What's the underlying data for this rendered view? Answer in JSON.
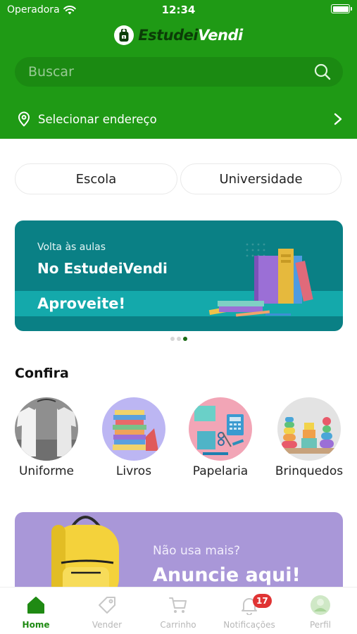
{
  "status_bar": {
    "carrier": "Operadora",
    "time": "12:34"
  },
  "header": {
    "logo_part1": "Estudei",
    "logo_part2": "Vendi",
    "search_placeholder": "Buscar",
    "address_label": "Selecionar endereço"
  },
  "segments": [
    {
      "label": "Escola"
    },
    {
      "label": "Universidade"
    }
  ],
  "banner": {
    "small": "Volta às aulas",
    "big": "No EstudeiVendi",
    "cta": "Aproveite!",
    "page_count": 3,
    "active_page": 3
  },
  "section_title": "Confira",
  "categories": [
    {
      "label": "Uniforme",
      "icon": "tshirt-photo"
    },
    {
      "label": "Livros",
      "icon": "books-photo"
    },
    {
      "label": "Papelaria",
      "icon": "stationery-photo"
    },
    {
      "label": "Brinquedos",
      "icon": "toys-photo"
    }
  ],
  "promo": {
    "line1": "Não usa mais?",
    "line2": "Anuncie aqui!"
  },
  "tabs": [
    {
      "label": "Home",
      "icon": "home-icon",
      "active": true
    },
    {
      "label": "Vender",
      "icon": "tag-icon"
    },
    {
      "label": "Carrinho",
      "icon": "cart-icon"
    },
    {
      "label": "Notificações",
      "icon": "bell-icon",
      "badge": "17"
    },
    {
      "label": "Perfil",
      "icon": "avatar-icon"
    }
  ],
  "colors": {
    "brand_green": "#1f9a15",
    "search_bg": "#1b8a12",
    "banner_teal": "#0a8085",
    "promo_purple": "#a997d8",
    "badge_red": "#e03434"
  }
}
